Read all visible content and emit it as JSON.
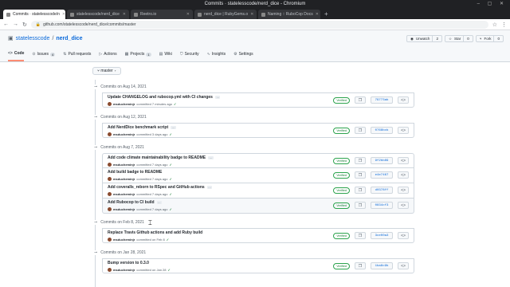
{
  "window": {
    "title": "Commits · statelesscode/nerd_dice - Chromium"
  },
  "tabs": [
    {
      "label": "Commits · statelesscode/n",
      "active": true
    },
    {
      "label": "statelesscode/nerd_dice",
      "active": false
    },
    {
      "label": "Reetro.io",
      "active": false
    },
    {
      "label": "nerd_dice | RubyGems.o",
      "active": false
    },
    {
      "label": "Naming :: RuboCop Docs",
      "active": false
    }
  ],
  "address": {
    "url": "github.com/statelesscode/nerd_dice/commits/master"
  },
  "repo": {
    "owner": "statelesscode",
    "name": "nerd_dice",
    "actions": [
      {
        "label": "Unwatch",
        "count": "2"
      },
      {
        "label": "Star",
        "count": "0"
      },
      {
        "label": "Fork",
        "count": "0"
      }
    ]
  },
  "repo_nav": [
    {
      "label": "Code",
      "icon": "<>",
      "badge": ""
    },
    {
      "label": "Issues",
      "icon": "⊙",
      "badge": "4"
    },
    {
      "label": "Pull requests",
      "icon": "⇅",
      "badge": ""
    },
    {
      "label": "Actions",
      "icon": "▷",
      "badge": ""
    },
    {
      "label": "Projects",
      "icon": "▦",
      "badge": "1"
    },
    {
      "label": "Wiki",
      "icon": "▤",
      "badge": ""
    },
    {
      "label": "Security",
      "icon": "⛉",
      "badge": ""
    },
    {
      "label": "Insights",
      "icon": "∿",
      "badge": ""
    },
    {
      "label": "Settings",
      "icon": "⚙",
      "badge": ""
    }
  ],
  "branch": {
    "label": "master"
  },
  "groups": [
    {
      "header": "Commits on Aug 14, 2021",
      "commits": [
        {
          "message": "Update CHANGELOG and rubocop.yml with CI changes",
          "author": "msducheminjr",
          "time": "committed 7 minutes ago",
          "verified": "Verified",
          "sha": "79773ab"
        }
      ]
    },
    {
      "header": "Commits on Aug 12, 2021",
      "commits": [
        {
          "message": "Add NerdDice benchmark script",
          "author": "msducheminjr",
          "time": "committed 3 days ago",
          "verified": "Verified",
          "sha": "0768bcb"
        }
      ]
    },
    {
      "header": "Commits on Aug 7, 2021",
      "commits": [
        {
          "message": "Add code climate maintainability badge to README",
          "author": "msducheminjr",
          "time": "committed 7 days ago",
          "verified": "Verified",
          "sha": "9f2bb89"
        },
        {
          "message": "Add build badge to README",
          "author": "msducheminjr",
          "time": "committed 7 days ago",
          "verified": "Verified",
          "sha": "e4e7467"
        },
        {
          "message": "Add coveralls_reborn to RSpec and GitHub actions",
          "author": "msducheminjr",
          "time": "committed 7 days ago",
          "verified": "Verified",
          "sha": "d0378ff"
        },
        {
          "message": "Add Rubocop to CI build",
          "author": "msducheminjr",
          "time": "committed 7 days ago",
          "verified": "Verified",
          "sha": "0834cf3"
        }
      ]
    },
    {
      "header": "Commits on Feb 8, 2021",
      "commits": [
        {
          "message": "Replace Travis Github actions and add Ruby build",
          "author": "msducheminjr",
          "time": "committed on Feb 8",
          "verified": "Verified",
          "sha": "3ce00a3"
        }
      ]
    },
    {
      "header": "Commits on Jan 28, 2021",
      "commits": [
        {
          "message": "Bump version to 0.3.0",
          "author": "msducheminjr",
          "time": "committed on Jan 28",
          "verified": "Verified",
          "sha": "1ba8c9b"
        }
      ]
    }
  ]
}
